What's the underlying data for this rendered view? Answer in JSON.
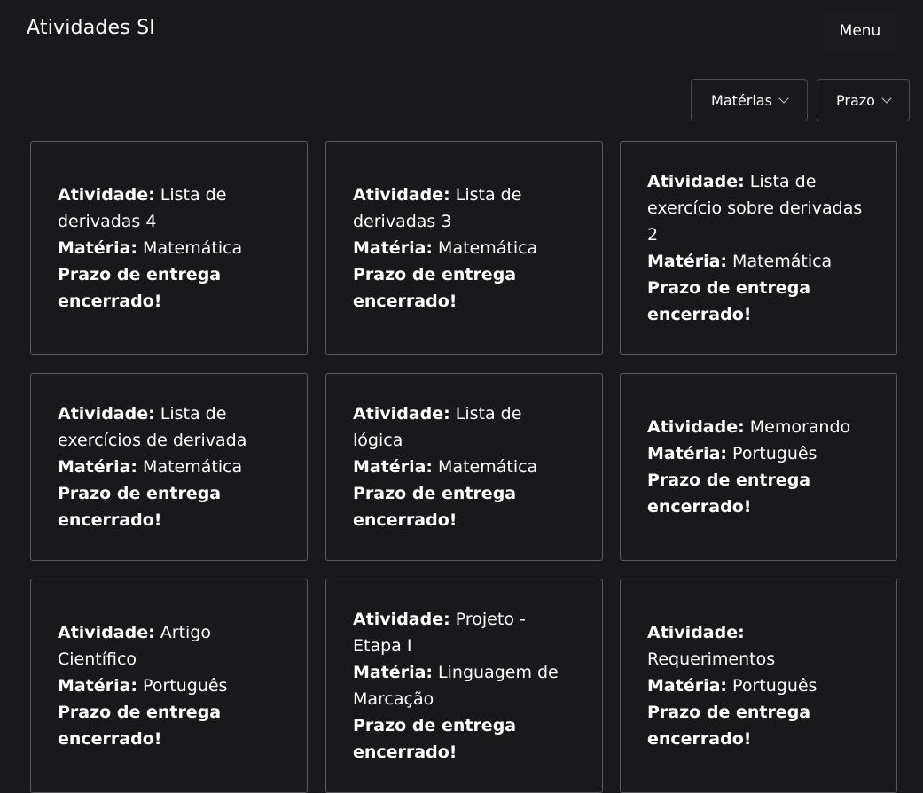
{
  "header": {
    "title": "Atividades SI",
    "menu_label": "Menu"
  },
  "filters": {
    "materias_label": "Matérias",
    "prazo_label": "Prazo"
  },
  "labels": {
    "atividade": "Atividade:",
    "materia": "Matéria:",
    "prazo": "Prazo de entrega encerrado!"
  },
  "cards": [
    {
      "atividade": "Lista de derivadas 4",
      "materia": "Matemática"
    },
    {
      "atividade": "Lista de derivadas 3",
      "materia": "Matemática"
    },
    {
      "atividade": "Lista de exercício sobre derivadas 2",
      "materia": "Matemática"
    },
    {
      "atividade": "Lista de exercícios de derivada",
      "materia": "Matemática"
    },
    {
      "atividade": "Lista de lógica",
      "materia": "Matemática"
    },
    {
      "atividade": "Memorando",
      "materia": "Português"
    },
    {
      "atividade": "Artigo Científico",
      "materia": "Português"
    },
    {
      "atividade": "Projeto - Etapa I",
      "materia": "Linguagem de Marcação"
    },
    {
      "atividade": "Requerimentos",
      "materia": "Português"
    }
  ]
}
